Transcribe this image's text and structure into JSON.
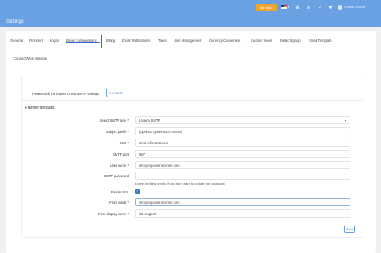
{
  "header": {
    "title": "Settings",
    "tour_label": "Take a tour",
    "user_name": "Prashap Kuumar"
  },
  "tabs": [
    {
      "label": "General"
    },
    {
      "label": "Providers"
    },
    {
      "label": "Logos"
    },
    {
      "label": "Email Configurations",
      "active": true
    },
    {
      "label": "Billing"
    },
    {
      "label": "Email Notifications"
    },
    {
      "label": "Taxes"
    },
    {
      "label": "User Management"
    },
    {
      "label": "Currency Conversion"
    },
    {
      "label": "Custom Views"
    },
    {
      "label": "Public Signup"
    },
    {
      "label": "Email Template"
    },
    {
      "label": "ConnectWise Manage"
    }
  ],
  "smtp": {
    "instruction": "Please click the button to test SMTP settings",
    "test_button": "Test SMTP"
  },
  "partner": {
    "section_title": "Partner defaults",
    "fields": [
      {
        "label": "Select SMTP type *",
        "value": "Legacy SMTP"
      },
      {
        "label": "Subject prefix *",
        "value": "[Spektra Systems LCI-demo]"
      },
      {
        "label": "Host *",
        "value": "smtp.office365.com"
      },
      {
        "label": "SMTP port",
        "value": "587"
      },
      {
        "label": "User name *",
        "value": "info@cspcontrolcenter.com"
      },
      {
        "label": "SMTP password",
        "value": ""
      }
    ],
    "password_hint": "Leave the field empty, if you don't want to update the password.",
    "enable_ssl_label": "Enable SSL",
    "from_email_label": "From email *",
    "from_email_value": "info@cspcontrolcenter.com",
    "from_display_label": "From display name *",
    "from_display_value": "C3 Support",
    "save_label": "Save"
  },
  "colors": {
    "topbar": "#6aa1e3",
    "accent": "#3a76c8",
    "tour_button": "#f0a528",
    "highlight": "#d9333a"
  }
}
